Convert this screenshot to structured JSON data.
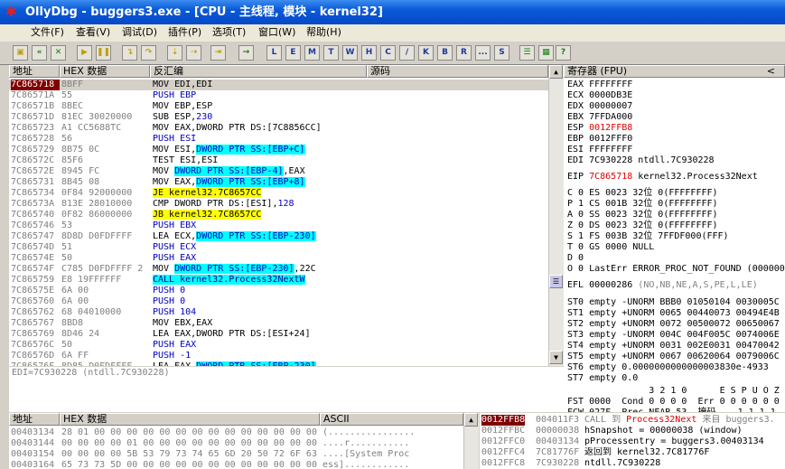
{
  "window": {
    "title": "OllyDbg - buggers3.exe - [CPU - 主线程, 模块 - kernel32]"
  },
  "menu": [
    "文件(F)",
    "查看(V)",
    "调试(D)",
    "插件(P)",
    "选项(T)",
    "窗口(W)",
    "帮助(H)"
  ],
  "toolbar_letters": [
    "L",
    "E",
    "M",
    "T",
    "W",
    "H",
    "C",
    "/",
    "K",
    "B",
    "R",
    "...",
    "S"
  ],
  "disasm": {
    "headers": {
      "addr": "地址",
      "hex": "HEX 数据",
      "disasm": "反汇编",
      "comment": "源码"
    },
    "rows": [
      {
        "a": "7C865718",
        "h": "8BFF",
        "d": [
          [
            "MOV EDI,EDI",
            ""
          ]
        ]
      },
      {
        "a": "7C86571A",
        "h": "55",
        "d": [
          [
            "PUSH EBP",
            "blu"
          ]
        ]
      },
      {
        "a": "7C86571B",
        "h": "8BEC",
        "d": [
          [
            "MOV EBP,ESP",
            ""
          ]
        ]
      },
      {
        "a": "7C86571D",
        "h": "81EC 30020000",
        "d": [
          [
            "SUB ESP,",
            ""
          ],
          [
            "230",
            "blu"
          ]
        ]
      },
      {
        "a": "7C865723",
        "h": "A1 CC5688TC",
        "d": [
          [
            "MOV EAX,DWORD PTR DS:[7C8856CC]",
            ""
          ]
        ]
      },
      {
        "a": "7C865728",
        "h": "56",
        "d": [
          [
            "PUSH ESI",
            "blu"
          ]
        ]
      },
      {
        "a": "7C865729",
        "h": "8B75 0C",
        "d": [
          [
            "MOV ESI,",
            ""
          ],
          [
            "DWORD PTR SS:[EBP+C]",
            "cy"
          ]
        ]
      },
      {
        "a": "7C86572C",
        "h": "85F6",
        "d": [
          [
            "TEST ESI,ESI",
            ""
          ]
        ]
      },
      {
        "a": "7C86572E",
        "h": "8945 FC",
        "d": [
          [
            "MOV ",
            ""
          ],
          [
            "DWORD PTR SS:[EBP-4]",
            "cy"
          ],
          [
            ",EAX",
            ""
          ]
        ]
      },
      {
        "a": "7C865731",
        "h": "8B45 08",
        "d": [
          [
            "MOV EAX,",
            ""
          ],
          [
            "DWORD PTR SS:[EBP+8]",
            "cy"
          ]
        ]
      },
      {
        "a": "7C865734",
        "h": "0F84 92000000",
        "d": [
          [
            "JE kernel32.7C8657CC",
            "yl"
          ]
        ]
      },
      {
        "a": "7C86573A",
        "h": "813E 28010000",
        "d": [
          [
            "CMP DWORD PTR DS:[ESI],",
            ""
          ],
          [
            "128",
            "blu"
          ]
        ]
      },
      {
        "a": "7C865740",
        "h": "0F82 86000000",
        "d": [
          [
            "JB kernel32.7C8657CC",
            "yl"
          ]
        ]
      },
      {
        "a": "7C865746",
        "h": "53",
        "d": [
          [
            "PUSH EBX",
            "blu"
          ]
        ]
      },
      {
        "a": "7C865747",
        "h": "8D8D D0FDFFFF",
        "d": [
          [
            "LEA ECX,",
            ""
          ],
          [
            "DWORD PTR SS:[EBP-230]",
            "cy"
          ]
        ]
      },
      {
        "a": "7C86574D",
        "h": "51",
        "d": [
          [
            "PUSH ECX",
            "blu"
          ]
        ]
      },
      {
        "a": "7C86574E",
        "h": "50",
        "d": [
          [
            "PUSH EAX",
            "blu"
          ]
        ]
      },
      {
        "a": "7C86574F",
        "h": "C785 D0FDFFFF 2",
        "d": [
          [
            "MOV ",
            ""
          ],
          [
            "DWORD PTR SS:[EBP-230]",
            "cy"
          ],
          [
            ",22C",
            ""
          ]
        ]
      },
      {
        "a": "7C865759",
        "h": "E8 19FFFFFF",
        "d": [
          [
            "CALL kernel32.Process32NextW",
            "cal"
          ]
        ]
      },
      {
        "a": "7C86575E",
        "h": "6A 00",
        "d": [
          [
            "PUSH 0",
            "blu"
          ]
        ]
      },
      {
        "a": "7C865760",
        "h": "6A 00",
        "d": [
          [
            "PUSH 0",
            "blu"
          ]
        ]
      },
      {
        "a": "7C865762",
        "h": "68 04010000",
        "d": [
          [
            "PUSH 104",
            "blu"
          ]
        ]
      },
      {
        "a": "7C865767",
        "h": "8BD8",
        "d": [
          [
            "MOV EBX,EAX",
            ""
          ]
        ]
      },
      {
        "a": "7C865769",
        "h": "8D46 24",
        "d": [
          [
            "LEA EAX,DWORD PTR DS:[ESI+24]",
            ""
          ]
        ]
      },
      {
        "a": "7C86576C",
        "h": "50",
        "d": [
          [
            "PUSH EAX",
            "blu"
          ]
        ]
      },
      {
        "a": "7C86576D",
        "h": "6A FF",
        "d": [
          [
            "PUSH -1",
            "blu"
          ]
        ]
      },
      {
        "a": "7C86576F",
        "h": "8D85 D0FDFFFF",
        "d": [
          [
            "LEA EAX,",
            ""
          ],
          [
            "DWORD PTR SS:[EBP-230]",
            "cy"
          ]
        ]
      }
    ],
    "info": "EDI=7C930228 (ntdll.7C930228)"
  },
  "registers": {
    "title": "寄存器 (FPU)",
    "title_arrow": "<",
    "general": [
      [
        "EAX",
        "FFFFFFFF",
        ""
      ],
      [
        "ECX",
        "0000DB3E",
        ""
      ],
      [
        "EDX",
        "00000007",
        ""
      ],
      [
        "EBX",
        "7FFDA000",
        ""
      ],
      [
        "ESP",
        "0012FFB8",
        "red"
      ],
      [
        "EBP",
        "0012FFF0",
        ""
      ],
      [
        "ESI",
        "FFFFFFFF",
        ""
      ],
      [
        "EDI",
        "7C930228 ntdll.7C930228",
        ""
      ]
    ],
    "eip": [
      "EIP",
      "7C865718",
      "kernel32.Process32Next"
    ],
    "flags": [
      "C 0  ES 0023 32位 0(FFFFFFFF)",
      "P 1  CS 001B 32位 0(FFFFFFFF)",
      "A 0  SS 0023 32位 0(FFFFFFFF)",
      "Z 0  DS 0023 32位 0(FFFFFFFF)",
      "S 1  FS 003B 32位 7FFDF000(FFF)",
      "T 0  GS 0000 NULL",
      "D 0",
      "O 0  LastErr ERROR_PROC_NOT_FOUND (000000"
    ],
    "efl": [
      "EFL",
      "00000286",
      "(NO,NB,NE,A,S,PE,L,LE)"
    ],
    "fpu": [
      "ST0 empty -UNORM BBB0 01050104 0030005C",
      "ST1 empty +UNORM 0065 00440073 00494E4B",
      "ST2 empty +UNORM 0072 00500072 00650067",
      "ST3 empty -UNORM 004C 004F005C 0074006E",
      "ST4 empty +UNORM 0031 002E0031 00470042",
      "ST5 empty +UNORM 0067 00620064 0079006C",
      "ST6 empty 0.0000000000000003830e-4933",
      "ST7 empty 0.0"
    ],
    "fpu_hdr": "               3 2 1 0      E S P U O Z",
    "fst": "FST 0000  Cond 0 0 0 0  Err 0 0 0 0 0 0",
    "fcw": "FCW 027F  Prec NEAR,53  掩码    1 1 1 1"
  },
  "dump": {
    "headers": {
      "addr": "地址",
      "hex": "HEX 数据",
      "ascii": "ASCII"
    },
    "rows": [
      {
        "a": "00403134",
        "h": "28 01 00 00 00 00 00 00 00 00 00 00 00 00 00 00",
        "s": "(................"
      },
      {
        "a": "00403144",
        "h": "00 00 00 00 01 00 00 00 00 00 00 00 00 00 00 00",
        "s": "....r..........."
      },
      {
        "a": "00403154",
        "h": "00 00 00 00 5B 53 79 73 74 65 6D 20 50 72 6F 63",
        "s": "....[System Proc"
      },
      {
        "a": "00403164",
        "h": "65 73 73 5D 00 00 00 00 00 00 00 00 00 00 00 00",
        "s": "ess]............"
      }
    ]
  },
  "stack": {
    "rows": [
      {
        "a": "0012FFB8",
        "v": "004011F3",
        "c": "CALL 到 Process32Next 来自 buggers3."
      },
      {
        "a": "0012FFBC",
        "v": "00000038",
        "c": "hSnapshot = 00000038 (window)"
      },
      {
        "a": "0012FFC0",
        "v": "00403134",
        "c": "pProcessentry = buggers3.00403134"
      },
      {
        "a": "0012FFC4",
        "v": "7C81776F",
        "c": "返回到 kernel32.7C81776F"
      },
      {
        "a": "0012FFC8",
        "v": "7C930228",
        "c": "ntdll.7C930228"
      }
    ]
  }
}
